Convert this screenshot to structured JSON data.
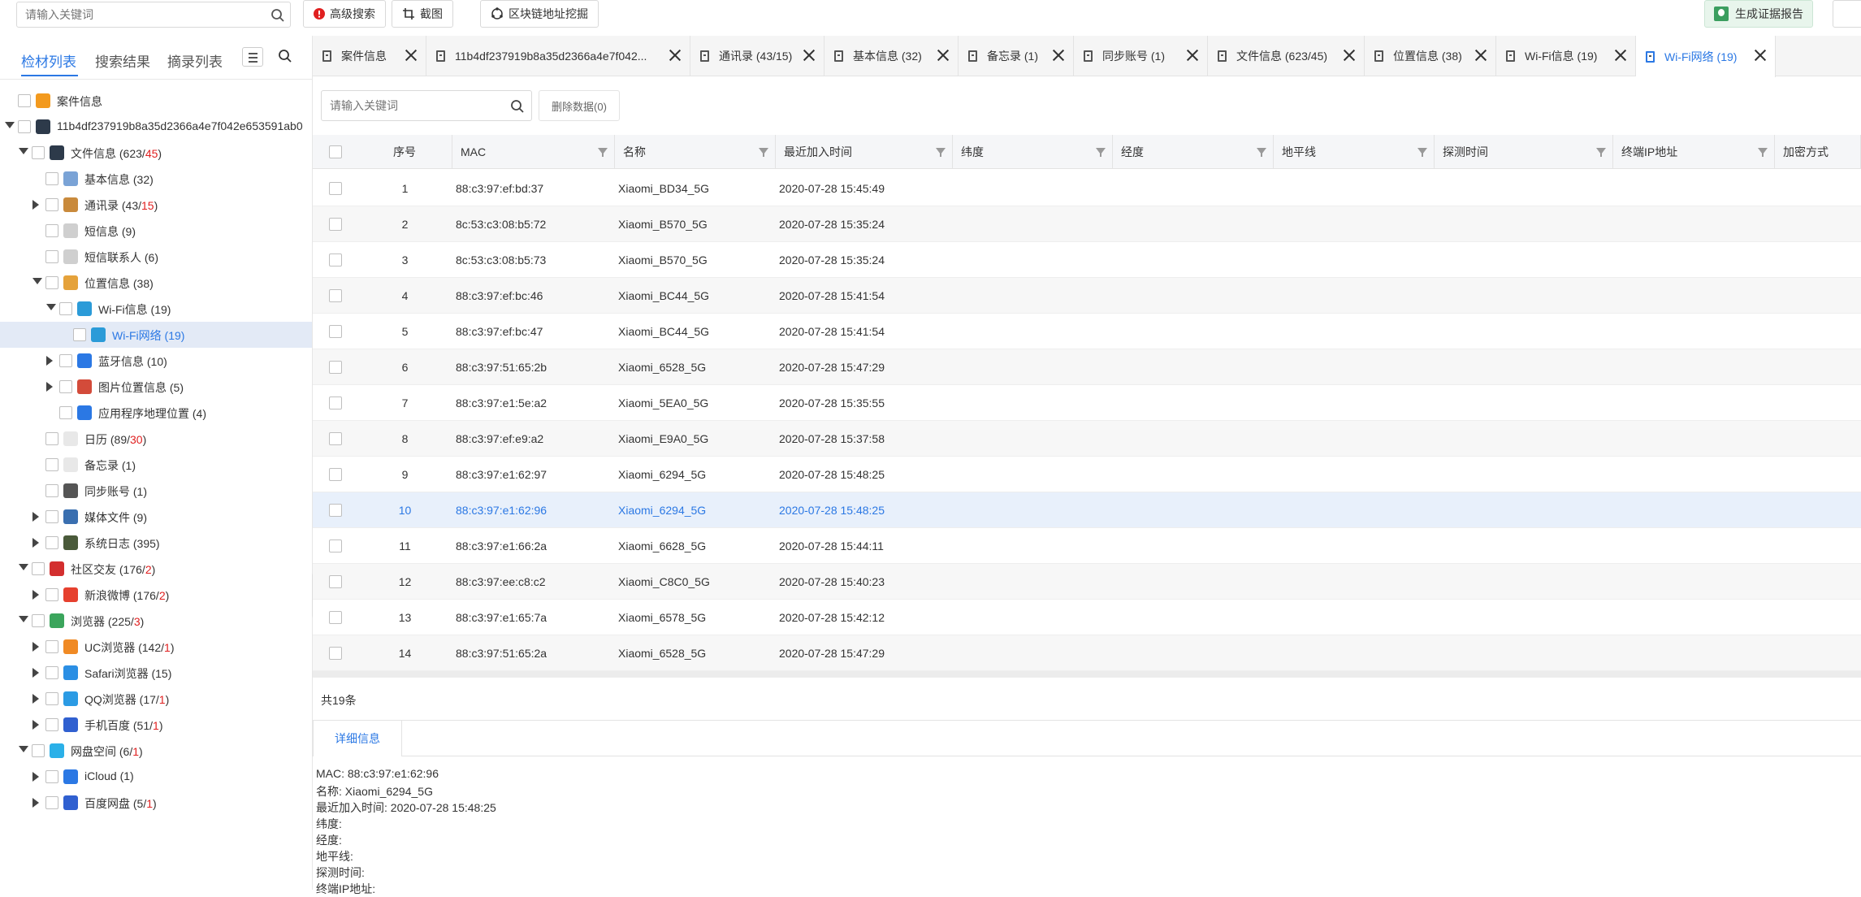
{
  "toolbar": {
    "search_placeholder": "请输入关键词",
    "advanced_search": "高级搜索",
    "screenshot": "截图",
    "blockchain": "区块链地址挖掘",
    "generate_report": "生成证据报告"
  },
  "sidebar": {
    "tabs": [
      "检材列表",
      "搜索结果",
      "摘录列表"
    ],
    "tree": [
      {
        "label": "案件信息",
        "num": "",
        "red": "",
        "level": 0,
        "arrow": "none",
        "icon": "case-icon",
        "color": "#f39a1e"
      },
      {
        "label": "11b4df237919b8a35d2366a4e7f042e653591ab0",
        "num": "",
        "red": "",
        "level": 0,
        "arrow": "down",
        "icon": "phone-icon",
        "color": "#2d3a4a"
      },
      {
        "label": "文件信息 (623/",
        "num": "",
        "red": "45",
        "level": 1,
        "arrow": "down",
        "icon": "phone-icon",
        "color": "#2d3a4a"
      },
      {
        "label": "基本信息 (32)",
        "num": "",
        "red": "",
        "level": 2,
        "arrow": "none",
        "icon": "info-icon",
        "color": "#7aa3d6"
      },
      {
        "label": "通讯录 (43/",
        "num": "",
        "red": "15",
        "level": 2,
        "arrow": "right",
        "icon": "contacts-icon",
        "color": "#c98a3c"
      },
      {
        "label": "短信息 (9)",
        "num": "",
        "red": "",
        "level": 2,
        "arrow": "none",
        "icon": "sms-icon",
        "color": "#cfcfcf"
      },
      {
        "label": "短信联系人 (6)",
        "num": "",
        "red": "",
        "level": 2,
        "arrow": "none",
        "icon": "sms-contact-icon",
        "color": "#cfcfcf"
      },
      {
        "label": "位置信息 (38)",
        "num": "",
        "red": "",
        "level": 2,
        "arrow": "down",
        "icon": "location-icon",
        "color": "#e5a23b"
      },
      {
        "label": "Wi-Fi信息 (19)",
        "num": "",
        "red": "",
        "level": 3,
        "arrow": "down",
        "icon": "wifi-icon",
        "color": "#2b9bd8"
      },
      {
        "label": "Wi-Fi网络 (19)",
        "num": "",
        "red": "",
        "level": 4,
        "arrow": "none",
        "icon": "wifi-icon",
        "color": "#2b9bd8",
        "selected": true
      },
      {
        "label": "蓝牙信息 (10)",
        "num": "",
        "red": "",
        "level": 3,
        "arrow": "right",
        "icon": "bluetooth-icon",
        "color": "#2b78e4"
      },
      {
        "label": "图片位置信息 (5)",
        "num": "",
        "red": "",
        "level": 3,
        "arrow": "right",
        "icon": "photo-location-icon",
        "color": "#d34b3a"
      },
      {
        "label": "应用程序地理位置 (4)",
        "num": "",
        "red": "",
        "level": 3,
        "arrow": "none",
        "icon": "app-location-icon",
        "color": "#2b78e4"
      },
      {
        "label": "日历 (89/",
        "num": "",
        "red": "30",
        "level": 2,
        "arrow": "none",
        "icon": "calendar-icon",
        "color": "#e8e8e8"
      },
      {
        "label": "备忘录 (1)",
        "num": "",
        "red": "",
        "level": 2,
        "arrow": "none",
        "icon": "memo-icon",
        "color": "#e8e8e8"
      },
      {
        "label": "同步账号 (1)",
        "num": "",
        "red": "",
        "level": 2,
        "arrow": "none",
        "icon": "account-icon",
        "color": "#555555"
      },
      {
        "label": "媒体文件 (9)",
        "num": "",
        "red": "",
        "level": 2,
        "arrow": "right",
        "icon": "media-icon",
        "color": "#3a6fb0"
      },
      {
        "label": "系统日志 (395)",
        "num": "",
        "red": "",
        "level": 2,
        "arrow": "right",
        "icon": "log-icon",
        "color": "#4a5a3a"
      },
      {
        "label": "社区交友 (176/",
        "num": "",
        "red": "2",
        "level": 1,
        "arrow": "down",
        "icon": "social-icon",
        "color": "#d32f2f"
      },
      {
        "label": "新浪微博 (176/",
        "num": "",
        "red": "2",
        "level": 2,
        "arrow": "right",
        "icon": "weibo-icon",
        "color": "#e6402e"
      },
      {
        "label": "浏览器 (225/",
        "num": "",
        "red": "3",
        "level": 1,
        "arrow": "down",
        "icon": "browser-icon",
        "color": "#3ba55c"
      },
      {
        "label": "UC浏览器 (142/",
        "num": "",
        "red": "1",
        "level": 2,
        "arrow": "right",
        "icon": "uc-browser-icon",
        "color": "#f08a24"
      },
      {
        "label": "Safari浏览器 (15)",
        "num": "",
        "red": "",
        "level": 2,
        "arrow": "right",
        "icon": "safari-icon",
        "color": "#2b8fe4"
      },
      {
        "label": "QQ浏览器 (17/",
        "num": "",
        "red": "1",
        "level": 2,
        "arrow": "right",
        "icon": "qq-browser-icon",
        "color": "#2b9be4"
      },
      {
        "label": "手机百度 (51/",
        "num": "",
        "red": "1",
        "level": 2,
        "arrow": "right",
        "icon": "baidu-icon",
        "color": "#3060d0"
      },
      {
        "label": "网盘空间 (6/",
        "num": "",
        "red": "1",
        "level": 1,
        "arrow": "down",
        "icon": "cloud-drive-icon",
        "color": "#2bb0e8"
      },
      {
        "label": "iCloud (1)",
        "num": "",
        "red": "",
        "level": 2,
        "arrow": "right",
        "icon": "icloud-icon",
        "color": "#2b78e4"
      },
      {
        "label": "百度网盘 (5/",
        "num": "",
        "red": "1",
        "level": 2,
        "arrow": "right",
        "icon": "baidu-pan-icon",
        "color": "#3060d0"
      }
    ]
  },
  "tabs": [
    {
      "label": "案件信息",
      "active": false
    },
    {
      "label": "11b4df237919b8a35d2366a4e7f042...",
      "active": false
    },
    {
      "label": "通讯录 (43/15)",
      "active": false
    },
    {
      "label": "基本信息 (32)",
      "active": false
    },
    {
      "label": "备忘录 (1)",
      "active": false
    },
    {
      "label": "同步账号 (1)",
      "active": false
    },
    {
      "label": "文件信息 (623/45)",
      "active": false
    },
    {
      "label": "位置信息 (38)",
      "active": false
    },
    {
      "label": "Wi-Fi信息 (19)",
      "active": false
    },
    {
      "label": "Wi-Fi网络 (19)",
      "active": true
    }
  ],
  "main": {
    "search_placeholder": "请输入关键词",
    "delete_data": "删除数据(0)",
    "columns": [
      "序号",
      "MAC",
      "名称",
      "最近加入时间",
      "纬度",
      "经度",
      "地平线",
      "探测时间",
      "终端IP地址",
      "加密方式"
    ],
    "rows": [
      {
        "no": "1",
        "mac": "88:c3:97:ef:bd:37",
        "name": "Xiaomi_BD34_5G",
        "time": "2020-07-28 15:45:49"
      },
      {
        "no": "2",
        "mac": "8c:53:c3:08:b5:72",
        "name": "Xiaomi_B570_5G",
        "time": "2020-07-28 15:35:24"
      },
      {
        "no": "3",
        "mac": "8c:53:c3:08:b5:73",
        "name": "Xiaomi_B570_5G",
        "time": "2020-07-28 15:35:24"
      },
      {
        "no": "4",
        "mac": "88:c3:97:ef:bc:46",
        "name": "Xiaomi_BC44_5G",
        "time": "2020-07-28 15:41:54"
      },
      {
        "no": "5",
        "mac": "88:c3:97:ef:bc:47",
        "name": "Xiaomi_BC44_5G",
        "time": "2020-07-28 15:41:54"
      },
      {
        "no": "6",
        "mac": "88:c3:97:51:65:2b",
        "name": "Xiaomi_6528_5G",
        "time": "2020-07-28 15:47:29"
      },
      {
        "no": "7",
        "mac": "88:c3:97:e1:5e:a2",
        "name": "Xiaomi_5EA0_5G",
        "time": "2020-07-28 15:35:55"
      },
      {
        "no": "8",
        "mac": "88:c3:97:ef:e9:a2",
        "name": "Xiaomi_E9A0_5G",
        "time": "2020-07-28 15:37:58"
      },
      {
        "no": "9",
        "mac": "88:c3:97:e1:62:97",
        "name": "Xiaomi_6294_5G",
        "time": "2020-07-28 15:48:25"
      },
      {
        "no": "10",
        "mac": "88:c3:97:e1:62:96",
        "name": "Xiaomi_6294_5G",
        "time": "2020-07-28 15:48:25",
        "selected": true
      },
      {
        "no": "11",
        "mac": "88:c3:97:e1:66:2a",
        "name": "Xiaomi_6628_5G",
        "time": "2020-07-28 15:44:11"
      },
      {
        "no": "12",
        "mac": "88:c3:97:ee:c8:c2",
        "name": "Xiaomi_C8C0_5G",
        "time": "2020-07-28 15:40:23"
      },
      {
        "no": "13",
        "mac": "88:c3:97:e1:65:7a",
        "name": "Xiaomi_6578_5G",
        "time": "2020-07-28 15:42:12"
      },
      {
        "no": "14",
        "mac": "88:c3:97:51:65:2a",
        "name": "Xiaomi_6528_5G",
        "time": "2020-07-28 15:47:29"
      }
    ],
    "total": "共19条"
  },
  "detail": {
    "tab": "详细信息",
    "lines": [
      "MAC:  88:c3:97:e1:62:96",
      "名称:  Xiaomi_6294_5G",
      "最近加入时间:  2020-07-28 15:48:25",
      "纬度:",
      "经度:",
      "地平线:",
      "探测时间:",
      "终端IP地址:"
    ]
  }
}
